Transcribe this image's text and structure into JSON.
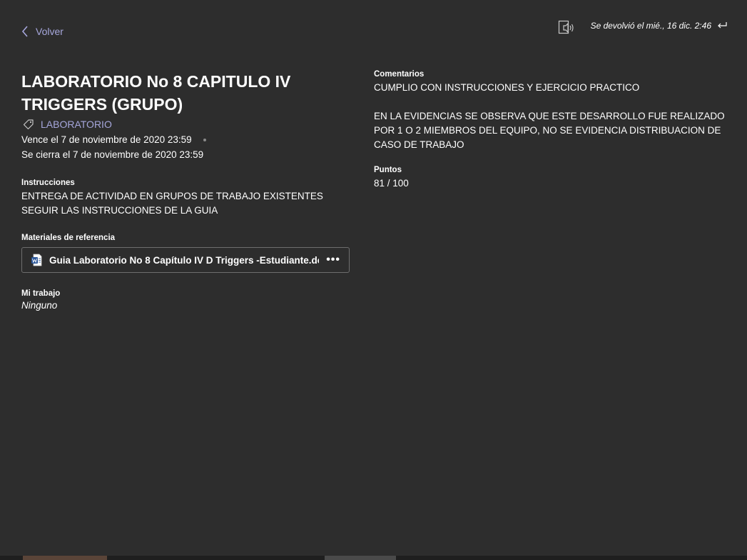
{
  "header": {
    "back_label": "Volver",
    "return_info": "Se devolvió el mié., 16 dic. 2:46"
  },
  "assignment": {
    "title": "LABORATORIO No 8 CAPITULO IV TRIGGERS (GRUPO)",
    "category": "LABORATORIO",
    "due": "Vence el 7 de noviembre de 2020 23:59",
    "closes": "Se cierra el 7 de noviembre de 2020 23:59",
    "instructions_label": "Instrucciones",
    "instructions_text": "ENTREGA DE ACTIVIDAD EN GRUPOS DE TRABAJO EXISTENTES\nSEGUIR LAS INSTRUCCIONES DE LA GUIA",
    "materials_label": "Materiales de referencia",
    "attachment_name": "Guia Laboratorio No 8 Capítulo IV D Triggers -Estudiante.do",
    "my_work_label": "Mi trabajo",
    "my_work_value": "Ninguno"
  },
  "feedback": {
    "comments_label": "Comentarios",
    "comments_text": "CUMPLIO CON INSTRUCCIONES Y EJERCICIO PRACTICO\n\nEN LA EVIDENCIAS SE OBSERVA QUE ESTE DESARROLLO FUE REALIZADO POR 1 O 2 MIEMBROS DEL EQUIPO, NO SE EVIDENCIA DISTRIBUACION DE CASO DE TRABAJO",
    "points_label": "Puntos",
    "points_value": "81 / 100"
  },
  "icons": {
    "back": "chevron-left-icon",
    "immersive_reader": "immersive-reader-icon",
    "returned": "return-arrow-icon",
    "tag": "tag-icon",
    "word": "word-document-icon",
    "more": "more-options-icon"
  },
  "colors": {
    "background": "#2d2d2d",
    "accent": "#a6a7dc",
    "word_blue": "#2b579a"
  }
}
